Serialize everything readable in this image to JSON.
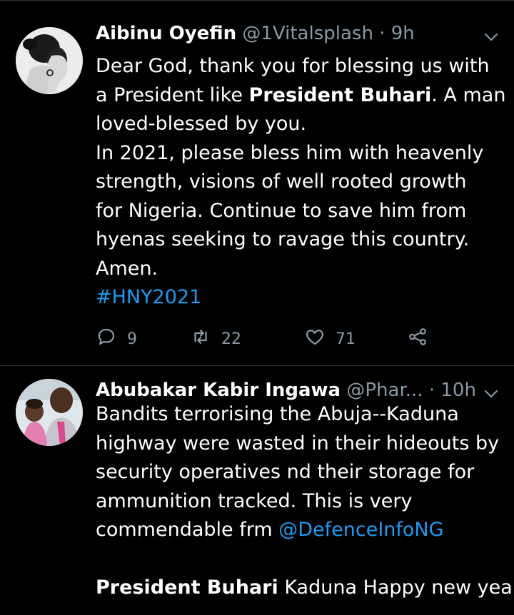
{
  "tweets": [
    {
      "name": "Aibinu Oyefin",
      "handle": "@1Vitalsplash",
      "separator": "·",
      "time": "9h",
      "lines": [
        {
          "pre": "Dear God, thank you for blessing us with"
        },
        {
          "pre": "a President like ",
          "bold": "President Buhari",
          "post": ". A man"
        },
        {
          "pre": "loved-blessed by you."
        },
        {
          "pre": "In 2021, please bless him with heavenly"
        },
        {
          "pre": "strength, visions of well rooted growth"
        },
        {
          "pre": "for Nigeria. Continue to save him from"
        },
        {
          "pre": "hyenas seeking to ravage this country."
        },
        {
          "pre": "Amen."
        }
      ],
      "hashtag": "#HNY2021",
      "actions": {
        "replies": "9",
        "retweets": "22",
        "likes": "71"
      }
    },
    {
      "name": "Abubakar Kabir Ingawa",
      "handle": "@Phar...",
      "separator": "·",
      "time": "10h",
      "lines": [
        {
          "pre": "Bandits terrorising the Abuja--Kaduna"
        },
        {
          "pre": "highway were wasted in their hideouts by"
        },
        {
          "pre": "security operatives nd their storage for"
        },
        {
          "pre": "ammunition tracked. This is very"
        },
        {
          "pre": "commendable frm ",
          "mention": "@DefenceInfoNG"
        },
        {
          "pre": ""
        },
        {
          "bold": "President Buhari",
          "post": " Kaduna Happy new year"
        }
      ]
    }
  ],
  "icons": {
    "more": "chevron-down-icon",
    "reply": "reply-icon",
    "retweet": "retweet-icon",
    "like": "heart-icon",
    "share": "share-icon"
  },
  "colors": {
    "background": "#000000",
    "text": "#ffffff",
    "secondary": "#8b98a5",
    "link": "#1d9bf0",
    "divider": "#2f3336"
  }
}
